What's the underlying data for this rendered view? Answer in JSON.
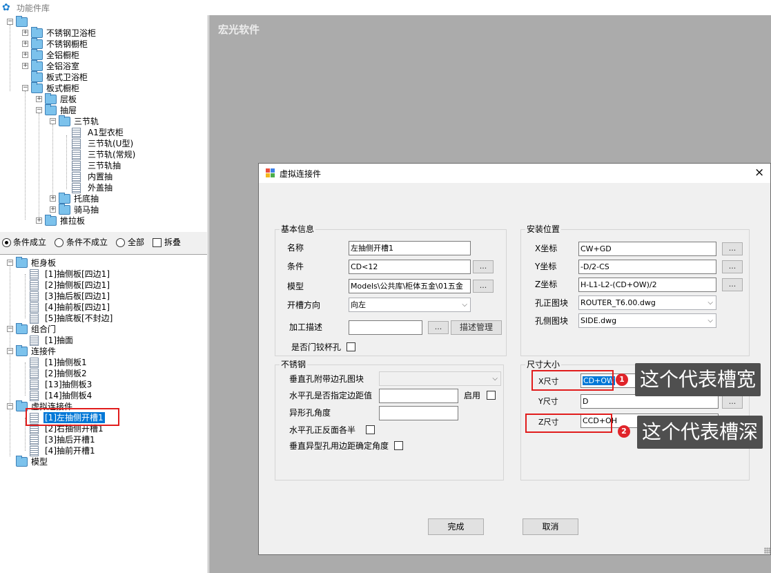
{
  "window": {
    "title": "功能件库"
  },
  "workspace": {
    "brand": "宏光软件"
  },
  "library_tree": [
    {
      "label": "不锈钢卫浴柜"
    },
    {
      "label": "不锈钢橱柜"
    },
    {
      "label": "全铝橱柜"
    },
    {
      "label": "全铝浴室"
    },
    {
      "label": "板式卫浴柜"
    },
    {
      "label": "板式橱柜"
    },
    {
      "label": "层板"
    },
    {
      "label": "抽屉"
    },
    {
      "label": "三节轨"
    },
    {
      "label": "A1型衣柜"
    },
    {
      "label": "三节轨(U型)"
    },
    {
      "label": "三节轨(常规)"
    },
    {
      "label": "三节轨抽"
    },
    {
      "label": "内置抽"
    },
    {
      "label": "外盖抽"
    },
    {
      "label": "托底抽"
    },
    {
      "label": "骑马抽"
    },
    {
      "label": "推拉板"
    }
  ],
  "filter": {
    "options": [
      "条件成立",
      "条件不成立",
      "全部"
    ],
    "selected": "条件成立",
    "collapse_label": "拆叠"
  },
  "part_tree": [
    {
      "label": "柜身板"
    },
    {
      "label": "[1]抽侧板[四边1]"
    },
    {
      "label": "[2]抽侧板[四边1]"
    },
    {
      "label": "[3]抽后板[四边1]"
    },
    {
      "label": "[4]抽前板[四边1]"
    },
    {
      "label": "[5]抽底板[不封边]"
    },
    {
      "label": "组合门"
    },
    {
      "label": "[1]抽面"
    },
    {
      "label": "连接件"
    },
    {
      "label": "[1]抽侧板1"
    },
    {
      "label": "[2]抽侧板2"
    },
    {
      "label": "[13]抽侧板3"
    },
    {
      "label": "[14]抽侧板4"
    },
    {
      "label": "虚拟连接件"
    },
    {
      "label": "[1]左抽侧开槽1"
    },
    {
      "label": "[2]右抽侧开槽1"
    },
    {
      "label": "[3]抽后开槽1"
    },
    {
      "label": "[4]抽前开槽1"
    },
    {
      "label": "模型"
    }
  ],
  "dialog": {
    "title": "虚拟连接件",
    "close": "×",
    "basic": {
      "title": "基本信息",
      "name_label": "名称",
      "name_value": "左抽侧开槽1",
      "condition_label": "条件",
      "condition_value": "CD<12",
      "model_label": "模型",
      "model_value": "Models\\公共库\\柜体五金\\01五金",
      "slot_dir_label": "开槽方向",
      "slot_dir_value": "向左",
      "process_label": "加工描述",
      "process_value": "",
      "desc_manage_label": "描述管理",
      "hinge_label": "是否门铰杯孔",
      "dots": "..."
    },
    "install": {
      "title": "安装位置",
      "x_label": "X坐标",
      "x_value": "CW+GD",
      "y_label": "Y坐标",
      "y_value": "-D/2-CS",
      "z_label": "Z坐标",
      "z_value": "H-L1-L2-(CD+OW)/2",
      "front_block_label": "孔正图块",
      "front_block_value": "ROUTER_T6.00.dwg",
      "side_block_label": "孔侧图块",
      "side_block_value": "SIDE.dwg"
    },
    "steel": {
      "title": "不锈钢",
      "vertical_block_label": "垂直孔附带边孔图块",
      "vertical_block_value": "",
      "horizontal_margin_label": "水平孔是否指定边距值",
      "enable_label": "启用",
      "shape_angle_label": "异形孔角度",
      "half_label": "水平孔正反面各半",
      "vertical_angle_label": "垂直异型孔用边距确定角度"
    },
    "size": {
      "title": "尺寸大小",
      "x_label": "X尺寸",
      "x_value": "CD+OW",
      "y_label": "Y尺寸",
      "y_value": "D",
      "z_label": "Z尺寸",
      "z_value": "CCD+OH"
    },
    "ok_label": "完成",
    "cancel_label": "取消"
  },
  "annotations": [
    {
      "number": "1",
      "text": "这个代表槽宽"
    },
    {
      "number": "2",
      "text": "这个代表槽深"
    }
  ],
  "colors": {
    "highlight_box": "#e11b1b",
    "selection": "#0078d7",
    "callout_bg": "#4f4f4f",
    "badge": "#e0242a"
  }
}
